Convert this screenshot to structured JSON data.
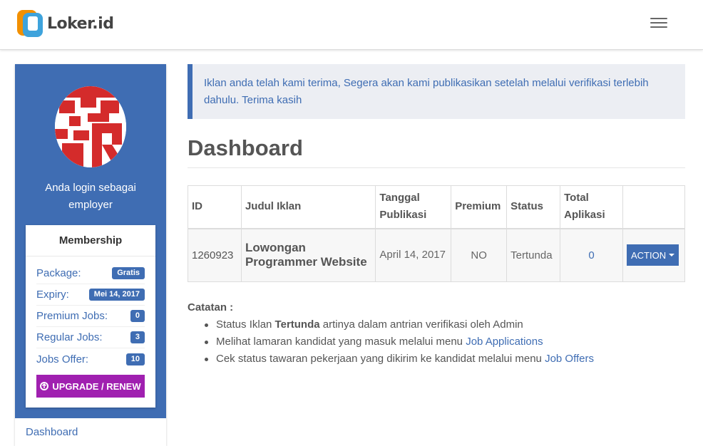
{
  "brand": {
    "name": "Loker.id"
  },
  "icons": {
    "logo": "loker-logo-icon",
    "menu": "hamburger-menu-icon",
    "upgrade": "arrow-circle-up-icon",
    "caret": "caret-down-icon"
  },
  "colors": {
    "primary": "#3f6db3",
    "upgrade": "#a020b0",
    "logo_orange": "#f29000",
    "logo_blue": "#3ea3dc"
  },
  "sidebar": {
    "login_text_line1": "Anda login sebagai",
    "login_text_line2": "employer",
    "membership": {
      "title": "Membership",
      "rows": [
        {
          "label": "Package:",
          "value": "Gratis"
        },
        {
          "label": "Expiry:",
          "value": "Mei 14, 2017"
        },
        {
          "label": "Premium Jobs:",
          "value": "0"
        },
        {
          "label": "Regular Jobs:",
          "value": "3"
        },
        {
          "label": "Jobs Offer:",
          "value": "10"
        }
      ],
      "upgrade_label": "UPGRADE / RENEW"
    },
    "menu": [
      {
        "label": "Dashboard"
      }
    ]
  },
  "alert": {
    "text": "Iklan anda telah kami terima, Segera akan kami publikasikan setelah melalui verifikasi terlebih dahulu. Terima kasih"
  },
  "page_title": "Dashboard",
  "table": {
    "headers": [
      "ID",
      "Judul Iklan",
      "Tanggal Publikasi",
      "Premium",
      "Status",
      "Total Aplikasi",
      ""
    ],
    "rows": [
      {
        "id": "1260923",
        "title": "Lowongan Programmer Website",
        "date": "April 14, 2017",
        "premium": "NO",
        "status": "Tertunda",
        "total": "0",
        "action": "ACTION"
      }
    ]
  },
  "notes": {
    "title": "Catatan :",
    "item1": {
      "pre": "Status Iklan ",
      "bold": "Tertunda",
      "post": " artinya dalam antrian verifikasi oleh Admin"
    },
    "item2": {
      "pre": "Melihat lamaran kandidat yang masuk melalui menu ",
      "link": "Job Applications"
    },
    "item3": {
      "pre": "Cek status tawaran pekerjaan yang dikirim ke kandidat melalui menu ",
      "link": "Job Offers"
    }
  }
}
